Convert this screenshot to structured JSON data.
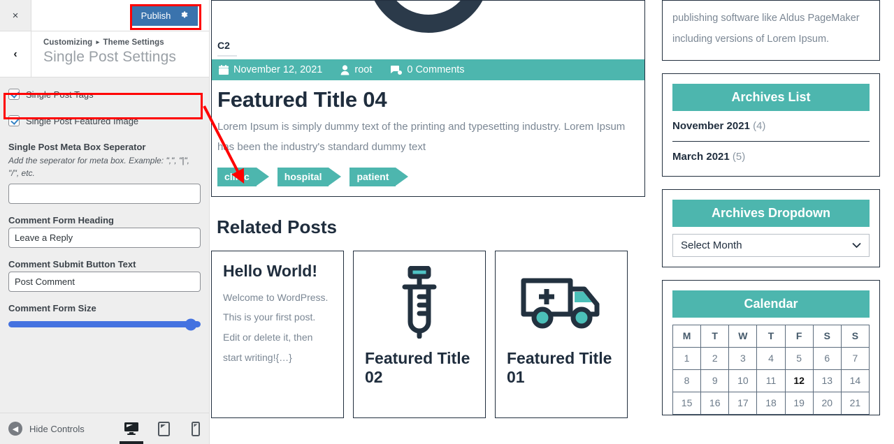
{
  "customizer": {
    "close_label": "×",
    "publish_label": "Publish",
    "gear_icon": "gear-icon",
    "back_label": "‹",
    "breadcrumb_root": "Customizing",
    "breadcrumb_sep": "▸",
    "breadcrumb_parent": "Theme Settings",
    "panel_title": "Single Post Settings",
    "controls": {
      "tags_checkbox_label": "Single Post Tags",
      "featured_checkbox_label": "Single Post Featured Image",
      "separator_label": "Single Post Meta Box Seperator",
      "separator_desc": "Add the seperator for meta box. Example: \",\", \"|\", \"/\", etc.",
      "separator_value": "",
      "separator_placeholder": "",
      "comment_heading_label": "Comment Form Heading",
      "comment_heading_value": "Leave a Reply",
      "comment_submit_label": "Comment Submit Button Text",
      "comment_submit_value": "Post Comment",
      "form_size_label": "Comment Form Size",
      "form_size_percent": 95
    },
    "footer": {
      "hide_controls_label": "Hide Controls",
      "devices": [
        {
          "name": "desktop-preview-icon",
          "active": true
        },
        {
          "name": "tablet-preview-icon",
          "active": false
        },
        {
          "name": "mobile-preview-icon",
          "active": false
        }
      ]
    }
  },
  "preview": {
    "post": {
      "category": "C2",
      "meta": {
        "date": "November 12, 2021",
        "author": "root",
        "comments": "0 Comments"
      },
      "title": "Featured Title 04",
      "excerpt": "Lorem Ipsum is simply dummy text of the printing and typesetting industry. Lorem Ipsum has been the industry's standard dummy text",
      "tags": [
        "clinic",
        "hospital",
        "patient"
      ]
    },
    "related": {
      "heading": "Related Posts",
      "cards": [
        {
          "kind": "text",
          "title": "Hello World!",
          "text": "Welcome to WordPress. This is your first post. Edit or delete it, then start writing!{…}"
        },
        {
          "kind": "icon",
          "icon": "syringe-icon",
          "title": "Featured Title 02"
        },
        {
          "kind": "icon",
          "icon": "ambulance-icon",
          "title": "Featured Title 01"
        }
      ]
    },
    "sidebar": {
      "text_widget": "publishing software like Aldus PageMaker including versions of Lorem Ipsum.",
      "archives_list": {
        "title": "Archives List",
        "items": [
          {
            "label": "November 2021",
            "count": "(4)"
          },
          {
            "label": "March 2021",
            "count": "(5)"
          }
        ]
      },
      "archives_dropdown": {
        "title": "Archives Dropdown",
        "selected": "Select Month"
      },
      "calendar": {
        "title": "Calendar",
        "day_headers": [
          "M",
          "T",
          "W",
          "T",
          "F",
          "S",
          "S"
        ],
        "weeks": [
          [
            "1",
            "2",
            "3",
            "4",
            "5",
            "6",
            "7"
          ],
          [
            "8",
            "9",
            "10",
            "11",
            "12",
            "13",
            "14"
          ],
          [
            "15",
            "16",
            "17",
            "18",
            "19",
            "20",
            "21"
          ]
        ],
        "today": "12"
      }
    }
  },
  "colors": {
    "teal": "#4db6ae",
    "publish_blue": "#3a73ad",
    "annotation_red": "#ff0000",
    "slider_blue": "#4472e0",
    "dark_navy": "#1f2d3d"
  }
}
